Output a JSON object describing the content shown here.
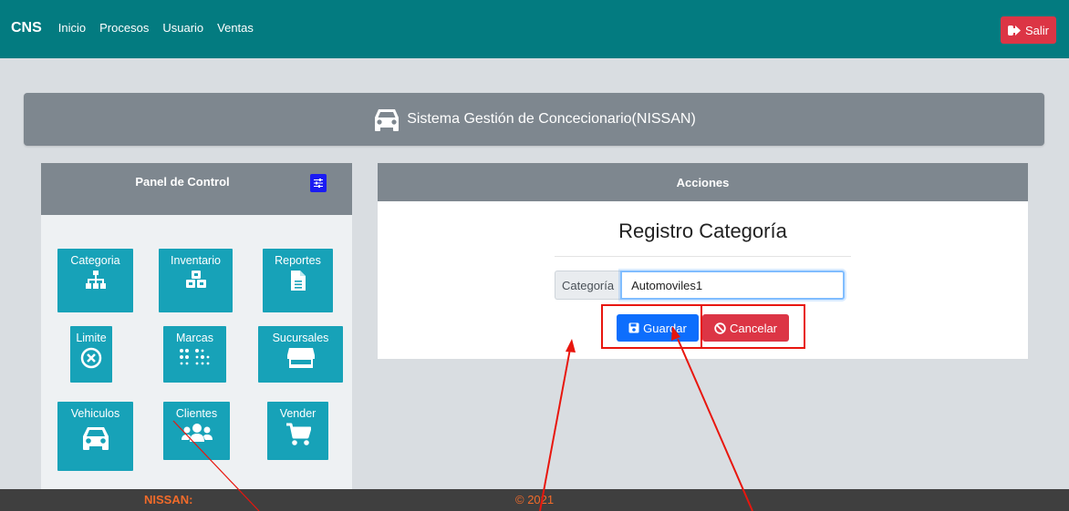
{
  "nav": {
    "brand": "CNS",
    "links": [
      "Inicio",
      "Procesos",
      "Usuario",
      "Ventas"
    ],
    "logout_label": "Salir"
  },
  "header": {
    "title": "Sistema Gestión de Concecionario(NISSAN)"
  },
  "panel": {
    "title": "Panel de Control",
    "tiles": [
      {
        "label": "Categoria",
        "icon": "sitemap-icon"
      },
      {
        "label": "Inventario",
        "icon": "cubes-icon"
      },
      {
        "label": "Reportes",
        "icon": "file-icon"
      },
      {
        "label": "Limite",
        "icon": "times-circle-icon"
      },
      {
        "label": "Marcas",
        "icon": "braille-icon"
      },
      {
        "label": "Sucursales",
        "icon": "store-icon"
      },
      {
        "label": "Vehiculos",
        "icon": "car-icon"
      },
      {
        "label": "Clientes",
        "icon": "users-icon"
      },
      {
        "label": "Vender",
        "icon": "cart-icon"
      }
    ]
  },
  "actions": {
    "title": "Acciones",
    "form_title": "Registro Categoría",
    "field_label": "Categoría",
    "field_value": "Automoviles1",
    "save_label": "Guardar",
    "cancel_label": "Cancelar"
  },
  "footer": {
    "brand": "NISSAN:",
    "copyright": "© 2021"
  },
  "colors": {
    "navbar": "#037b80",
    "danger": "#dc3545",
    "primary": "#0d6efd",
    "tile": "#17a2b8",
    "annotation": "#e8160e"
  }
}
